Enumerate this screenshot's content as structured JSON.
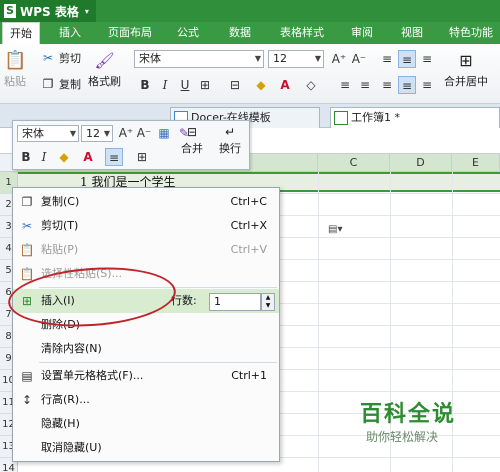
{
  "app": {
    "logo": "S",
    "name": "WPS 表格",
    "arrow": "▾"
  },
  "menubar": {
    "tabs": [
      {
        "label": "开始",
        "active": true
      },
      {
        "label": "插入"
      },
      {
        "label": "页面布局"
      },
      {
        "label": "公式"
      },
      {
        "label": "数据"
      },
      {
        "label": "表格样式"
      },
      {
        "label": "审阅"
      },
      {
        "label": "视图"
      },
      {
        "label": "特色功能"
      }
    ]
  },
  "ribbon": {
    "paste": "粘贴",
    "cut": "剪切",
    "copy": "复制",
    "format_painter": "格式刷",
    "font_name": "宋体",
    "font_size": "12",
    "merge_center": "合并居中"
  },
  "tabbar": {
    "tab1": "Docer-在线模板",
    "tab2": "工作簿1 *"
  },
  "grid": {
    "columns": [
      "C",
      "D",
      "E"
    ],
    "rows": [
      "1",
      "2",
      "3",
      "4",
      "5",
      "6",
      "7",
      "8",
      "9",
      "10",
      "11",
      "12",
      "13",
      "14"
    ],
    "a1_text": "1 我们是一个学生"
  },
  "minitoolbar": {
    "font_name": "宋体",
    "font_size": "12",
    "bold": "B",
    "italic": "I",
    "merge": "合并",
    "wrap": "换行"
  },
  "context_menu": {
    "items": [
      {
        "label": "复制(C)",
        "shortcut": "Ctrl+C"
      },
      {
        "label": "剪切(T)",
        "shortcut": "Ctrl+X"
      },
      {
        "label": "粘贴(P)",
        "shortcut": "Ctrl+V"
      },
      {
        "label": "选择性粘贴(S)..."
      },
      {
        "label": "插入(I)"
      },
      {
        "label": "删除(D)"
      },
      {
        "label": "清除内容(N)"
      },
      {
        "label": "设置单元格格式(F)...",
        "shortcut": "Ctrl+1"
      },
      {
        "label": "行高(R)..."
      },
      {
        "label": "隐藏(H)"
      },
      {
        "label": "取消隐藏(U)"
      }
    ],
    "rows_label": "行数:",
    "rows_value": "1"
  },
  "watermark": {
    "title": "百科全说",
    "subtitle": "助你轻松解决"
  },
  "colors": {
    "title_green": "#2f8f3a",
    "menu_green": "#3a9a44",
    "selection_green": "#3c9a3c",
    "annotation_red": "#c2232b"
  }
}
